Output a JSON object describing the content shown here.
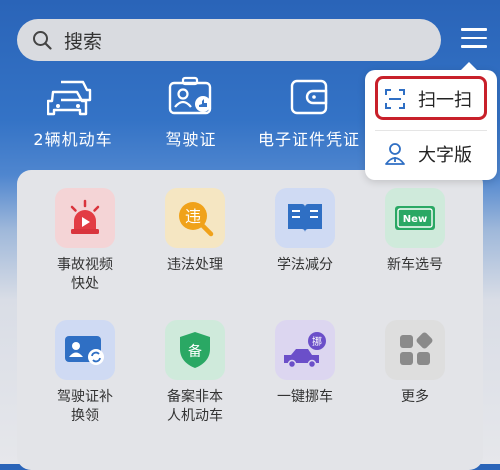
{
  "search": {
    "placeholder": "搜索"
  },
  "top_nav": [
    {
      "label": "2辆机动车"
    },
    {
      "label": "驾驶证"
    },
    {
      "label": "电子证件凭证"
    }
  ],
  "popup_menu": [
    {
      "label": "扫一扫",
      "icon": "scan-icon"
    },
    {
      "label": "大字版",
      "icon": "person-icon"
    }
  ],
  "services": [
    {
      "label": "事故视频快处",
      "icon": "siren-icon",
      "color": "#f4d4d6"
    },
    {
      "label": "违法处理",
      "icon": "violation-icon",
      "color": "#f5e6c2"
    },
    {
      "label": "学法减分",
      "icon": "book-icon",
      "color": "#cfdaf3"
    },
    {
      "label": "新车选号",
      "icon": "new-plate-icon",
      "color": "#cfeadb"
    },
    {
      "label": "驾驶证补换领",
      "icon": "license-card-icon",
      "color": "#cfdaf3"
    },
    {
      "label": "备案非本人机动车",
      "icon": "shield-icon",
      "color": "#cfeadb"
    },
    {
      "label": "一键挪车",
      "icon": "tow-truck-icon",
      "color": "#dcd6f0"
    },
    {
      "label": "更多",
      "icon": "more-icon",
      "color": "#dedede"
    }
  ],
  "colors": {
    "accent_blue": "#2f6fc4",
    "scan_highlight": "#c8202a"
  }
}
